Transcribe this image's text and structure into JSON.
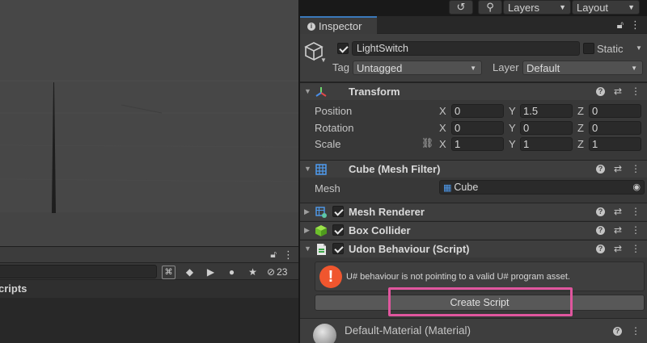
{
  "toolbar": {
    "layers_label": "Layers",
    "layout_label": "Layout"
  },
  "inspector": {
    "tab_label": "Inspector"
  },
  "gameobject": {
    "name": "LightSwitch",
    "static_label": "Static",
    "tag_label": "Tag",
    "tag_value": "Untagged",
    "layer_label": "Layer",
    "layer_value": "Default"
  },
  "transform": {
    "title": "Transform",
    "rows": [
      {
        "label": "Position",
        "x": "0",
        "y": "1.5",
        "z": "0"
      },
      {
        "label": "Rotation",
        "x": "0",
        "y": "0",
        "z": "0"
      },
      {
        "label": "Scale",
        "x": "1",
        "y": "1",
        "z": "1"
      }
    ],
    "axis_x": "X",
    "axis_y": "Y",
    "axis_z": "Z"
  },
  "mesh_filter": {
    "title": "Cube (Mesh Filter)",
    "mesh_label": "Mesh",
    "mesh_value": "Cube"
  },
  "mesh_renderer": {
    "title": "Mesh Renderer"
  },
  "box_collider": {
    "title": "Box Collider"
  },
  "udon": {
    "title": "Udon Behaviour (Script)",
    "warning_icon_text": "!",
    "warning": "U# behaviour is not pointing to a valid U# program asset.",
    "create_button": "Create Script"
  },
  "material": {
    "name": "Default-Material (Material)"
  },
  "project": {
    "header_label": "cripts",
    "hidden_count": "23"
  },
  "colors": {
    "accent_tab": "#3a79bb",
    "highlight": "#e0569e",
    "warning": "#f0562e"
  }
}
